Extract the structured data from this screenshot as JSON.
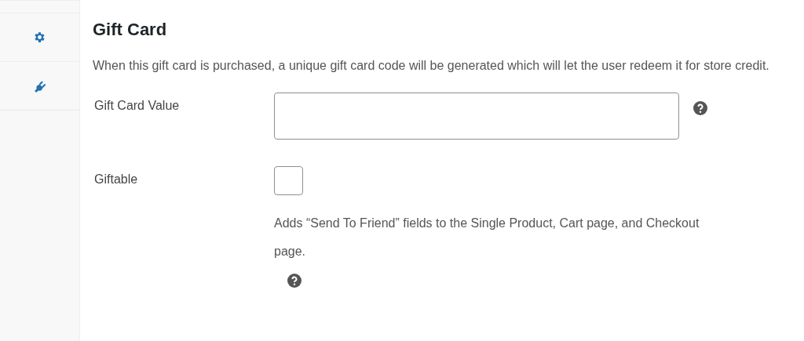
{
  "section": {
    "title": "Gift Card",
    "description": "When this gift card is purchased, a unique gift card code will be generated which will let the user redeem it for store credit."
  },
  "fields": [
    {
      "kind": "text",
      "label": "Gift Card Value",
      "help": true
    },
    {
      "kind": "checkbox",
      "label": "Giftable",
      "checked": false,
      "description": "Adds “Send To Friend” fields to the Single Product, Cart page, and Checkout page.",
      "help": true
    }
  ]
}
